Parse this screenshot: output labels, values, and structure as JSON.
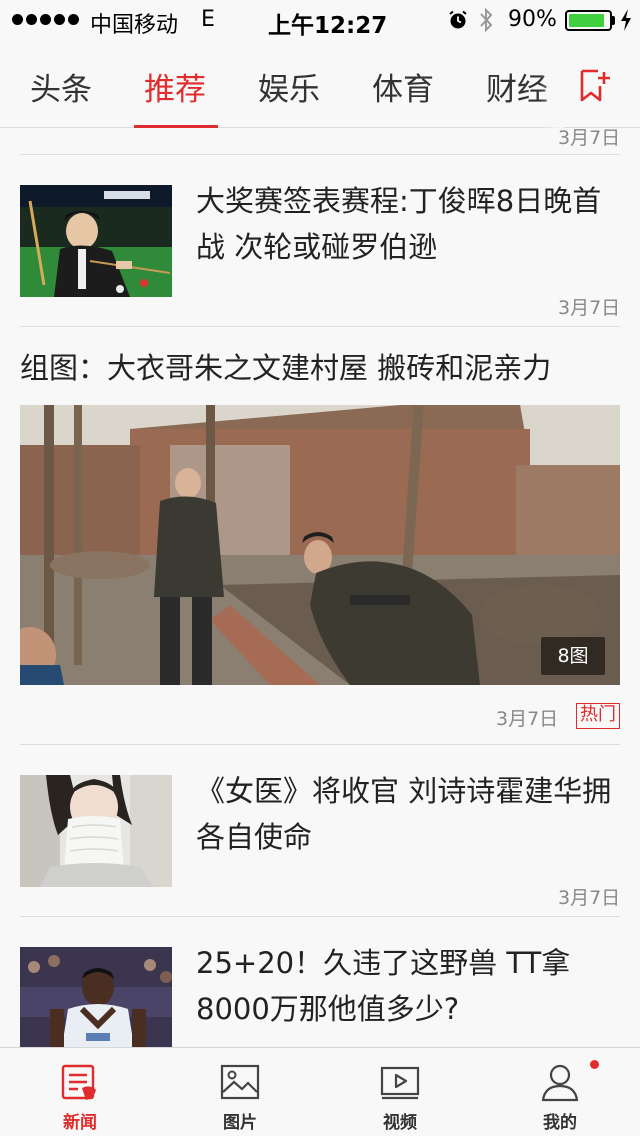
{
  "status_bar": {
    "carrier": "中国移动",
    "network": "E",
    "time": "上午12:27",
    "battery_percent": "90%",
    "battery_level": 0.9
  },
  "tabs": [
    {
      "label": "头条",
      "active": false
    },
    {
      "label": "推荐",
      "active": true
    },
    {
      "label": "娱乐",
      "active": false
    },
    {
      "label": "体育",
      "active": false
    },
    {
      "label": "财经",
      "active": false
    }
  ],
  "feed": {
    "top_partial_date": "3月7日",
    "articles": [
      {
        "headline": "大奖赛签表赛程:丁俊晖8日晚首战 次轮或碰罗伯逊",
        "date": "3月7日",
        "thumbnail": "snooker-player-photo"
      },
      {
        "headline": "《女医》将收官 刘诗诗霍建华拥各自使命",
        "date": "3月7日",
        "thumbnail": "actress-veil-photo"
      },
      {
        "headline": "25+20！久违了这野兽 TT拿8000万那他值多少?",
        "thumbnail": "basketball-player-photo"
      }
    ],
    "gallery": {
      "title": "组图：大衣哥朱之文建村屋 搬砖和泥亲力",
      "photo_count": "8图",
      "date": "3月7日",
      "badge": "热门"
    }
  },
  "bottom_nav": [
    {
      "label": "新闻",
      "icon": "news-icon",
      "active": true
    },
    {
      "label": "图片",
      "icon": "picture-icon",
      "active": false
    },
    {
      "label": "视频",
      "icon": "video-icon",
      "active": false
    },
    {
      "label": "我的",
      "icon": "profile-icon",
      "active": false
    }
  ],
  "colors": {
    "accent": "#e02c2c",
    "background": "#f8f8f8",
    "divider": "#dddddd",
    "date_text": "#888888"
  }
}
